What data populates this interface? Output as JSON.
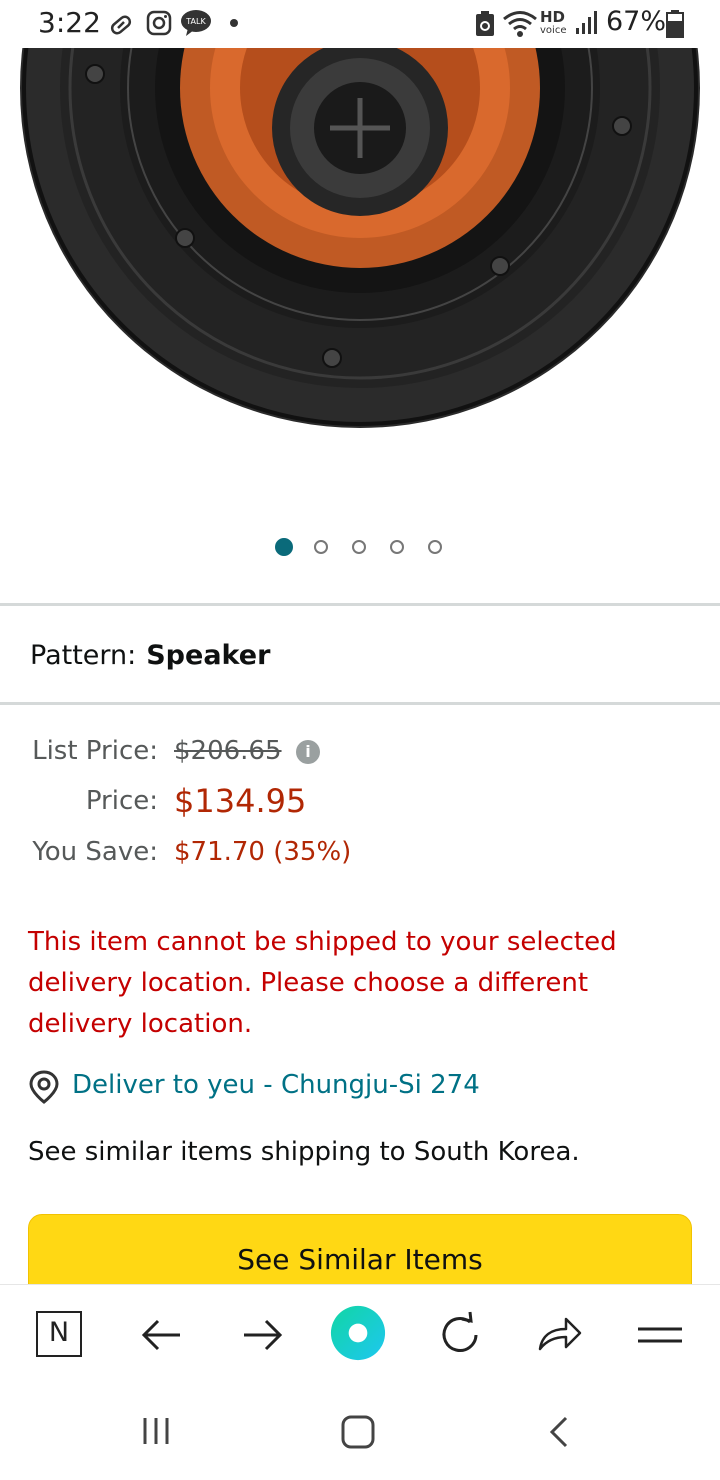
{
  "status_bar": {
    "time": "3:22",
    "hd_label": "HD",
    "hd_sub": "voice",
    "battery": "67%",
    "icons": [
      "pill-icon",
      "instagram-icon",
      "kakaotalk-icon",
      "dot-icon",
      "recycle-icon",
      "wifi-icon",
      "signal-icon",
      "battery-icon"
    ],
    "talk_label": "TALK"
  },
  "product": {
    "image_name": "speaker-image",
    "carousel_count": 5,
    "carousel_active": 1
  },
  "pattern": {
    "label": "Pattern:",
    "value": "Speaker"
  },
  "pricing": {
    "list_label": "List Price:",
    "list_value": "$206.65",
    "price_label": "Price:",
    "price_value": "$134.95",
    "save_label": "You Save:",
    "save_value": "$71.70 (35%)"
  },
  "delivery": {
    "warning": "This item cannot be shipped to your selected delivery location. Please choose a different delivery location.",
    "deliver_to": "Deliver to yeu - Chungju-Si 274",
    "similar_text": "See similar items shipping to South Korea.",
    "button_label": "See Similar Items"
  },
  "browser_toolbar": {
    "icons": [
      "naver-icon",
      "back-arrow-icon",
      "forward-arrow-icon",
      "home-circle-icon",
      "refresh-icon",
      "share-icon",
      "menu-icon"
    ],
    "naver_label": "N"
  },
  "colors": {
    "accent_teal": "#007185",
    "price_red": "#b12704",
    "warning_red": "#c40000",
    "button_yellow": "#ffd814"
  }
}
